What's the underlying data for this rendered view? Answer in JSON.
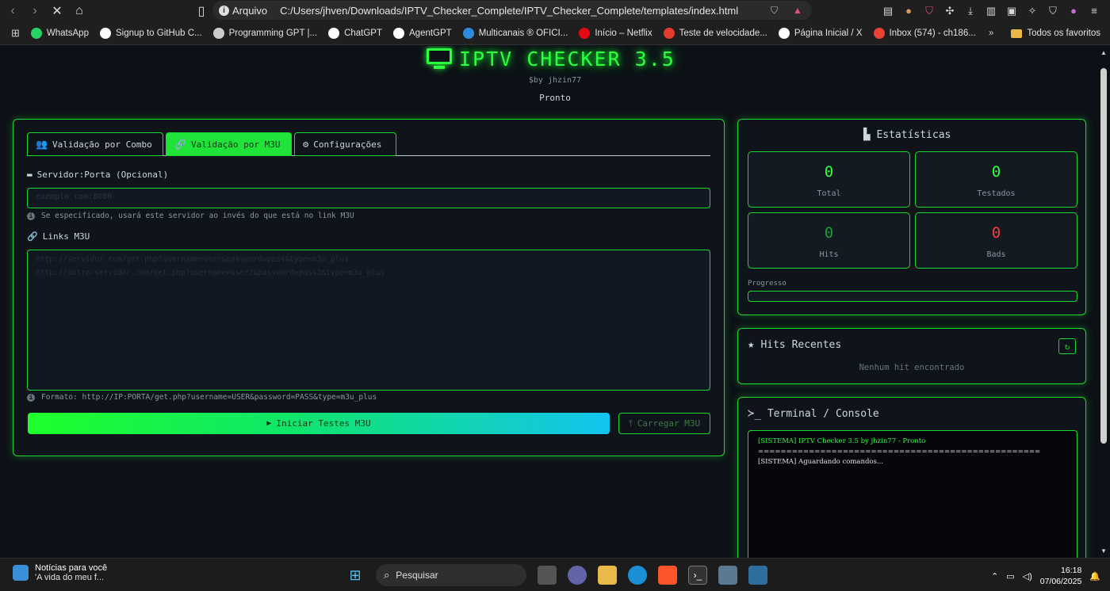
{
  "browser": {
    "protocol_label": "Arquivo",
    "url": "C:/Users/jhven/Downloads/IPTV_Checker_Complete/IPTV_Checker_Complete/templates/index.html",
    "bookmarks": [
      {
        "label": "WhatsApp",
        "color": "#25d366"
      },
      {
        "label": "Signup to GitHub C...",
        "color": "#ffffff"
      },
      {
        "label": "Programming GPT |...",
        "color": "#cccccc"
      },
      {
        "label": "ChatGPT",
        "color": "#ffffff"
      },
      {
        "label": "AgentGPT",
        "color": "#ffffff"
      },
      {
        "label": "Multicanais ® OFICI...",
        "color": "#2e8bdc"
      },
      {
        "label": "Início – Netflix",
        "color": "#e50914"
      },
      {
        "label": "Teste de velocidade...",
        "color": "#e63a2e"
      },
      {
        "label": "Página Inicial / X",
        "color": "#ffffff"
      },
      {
        "label": "Inbox (574) - ch186...",
        "color": "#ea4335"
      }
    ],
    "favorites_folder": "Todos os favoritos"
  },
  "app": {
    "title": "IPTV CHECKER 3.5",
    "subtitle": "$by jhzin77",
    "status": "Pronto",
    "accent": "#1bd92e"
  },
  "tabs": [
    {
      "label": "Validação por Combo",
      "icon": "users-icon",
      "active": false
    },
    {
      "label": "Validação por M3U",
      "icon": "link-icon",
      "active": true
    },
    {
      "label": "Configurações",
      "icon": "gear-icon",
      "active": false
    }
  ],
  "form": {
    "server_label": "Servidor:Porta (Opcional)",
    "server_placeholder": "exemplo.com:8080",
    "server_hint": "Se especificado, usará este servidor ao invés do que está no link M3U",
    "links_label": "Links M3U",
    "links_placeholder": [
      "http://servidor.com/get.php?username=user&password=pass&type=m3u_plus",
      "http://outro-servidor.com/get.php?username=user2&password=pass2&type=m3u_plus"
    ],
    "format_hint": "Formato: http://IP:PORTA/get.php?username=USER&password=PASS&type=m3u_plus",
    "start_button": "Iniciar Testes M3U",
    "load_button": "Carregar M3U"
  },
  "stats": {
    "title": "Estatísticas",
    "boxes": [
      {
        "value": "0",
        "label": "Total",
        "color": "#2bff3e"
      },
      {
        "value": "0",
        "label": "Testados",
        "color": "#2bff3e"
      },
      {
        "value": "0",
        "label": "Hits",
        "color": "#1f9a3a"
      },
      {
        "value": "0",
        "label": "Bads",
        "color": "#ff3b3b"
      }
    ],
    "progress_label": "Progresso",
    "progress": 0
  },
  "hits": {
    "title": "Hits Recentes",
    "empty": "Nenhum hit encontrado"
  },
  "terminal": {
    "title": "Terminal / Console",
    "lines": [
      {
        "text": "[SISTEMA] IPTV Checker 3.5 by jhzin77 - Pronto",
        "color": "#2bff3e"
      },
      {
        "text": "==================================================",
        "color": "#e6e6e6"
      },
      {
        "text": "[SISTEMA] Aguardando comandos...",
        "color": "#e6e6e6"
      }
    ]
  },
  "taskbar": {
    "news_title": "Notícias para você",
    "news_sub": "'A vida do meu f...",
    "search": "Pesquisar",
    "time": "16:18",
    "date": "07/06/2025"
  }
}
